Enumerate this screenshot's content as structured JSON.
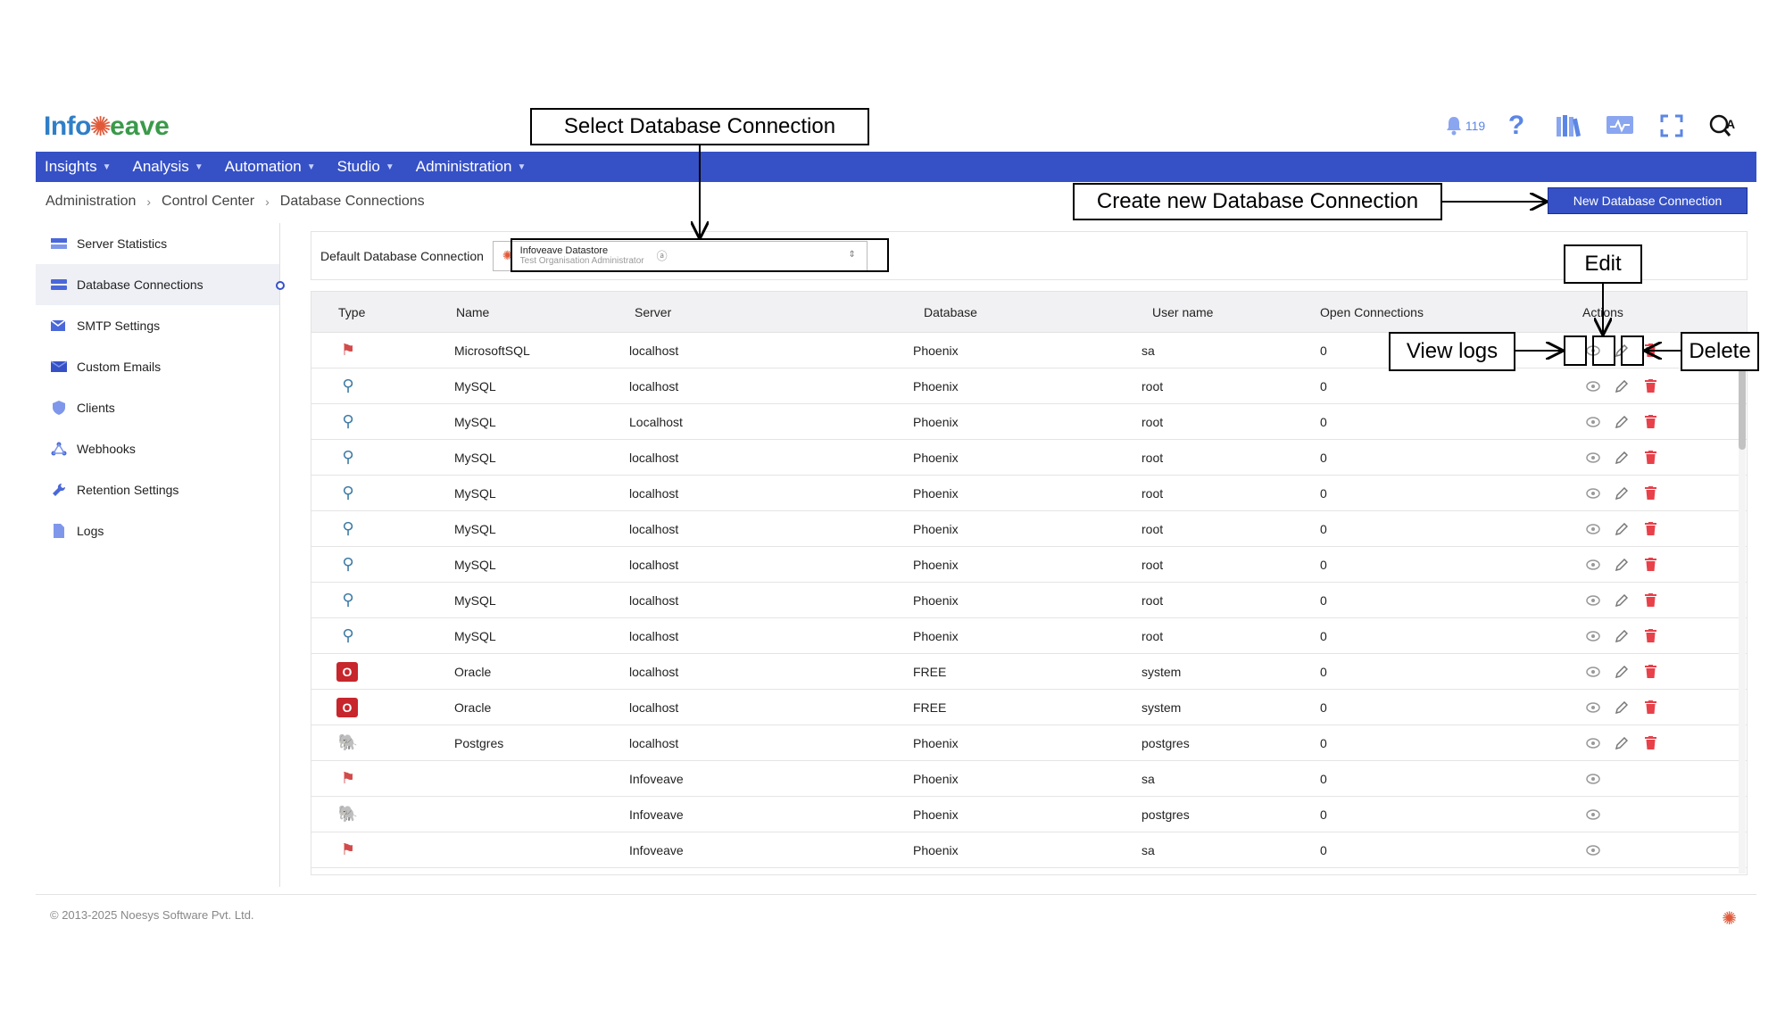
{
  "app": {
    "logo_part1": "Info",
    "logo_mark": "✺",
    "logo_part2": "eave",
    "logo_icon": "infoveave-logo"
  },
  "top_icons": {
    "notification_count": "119",
    "icons": [
      "bell-icon",
      "help-icon",
      "library-icon",
      "monitor-icon",
      "fullscreen-icon",
      "qa-icon"
    ]
  },
  "nav": [
    {
      "label": "Insights"
    },
    {
      "label": "Analysis"
    },
    {
      "label": "Automation"
    },
    {
      "label": "Studio"
    },
    {
      "label": "Administration"
    }
  ],
  "breadcrumb": [
    "Administration",
    "Control Center",
    "Database Connections"
  ],
  "new_button_label": "New Database Connection",
  "sidebar": {
    "items": [
      {
        "label": "Server Statistics",
        "icon": "server-stats-icon"
      },
      {
        "label": "Database Connections",
        "icon": "database-icon",
        "active": true
      },
      {
        "label": "SMTP Settings",
        "icon": "smtp-icon"
      },
      {
        "label": "Custom Emails",
        "icon": "email-icon"
      },
      {
        "label": "Clients",
        "icon": "shield-icon"
      },
      {
        "label": "Webhooks",
        "icon": "webhook-icon"
      },
      {
        "label": "Retention Settings",
        "icon": "wrench-icon"
      },
      {
        "label": "Logs",
        "icon": "document-icon"
      }
    ]
  },
  "default_connection": {
    "label": "Default Database Connection",
    "selected_name": "Infoveave Datastore",
    "selected_sub": "Test Organisation Administrator"
  },
  "table": {
    "headers": [
      "Type",
      "Name",
      "Server",
      "Database",
      "User name",
      "Open Connections",
      "Actions"
    ],
    "rows": [
      {
        "type": "mssql",
        "name": "MicrosoftSQL",
        "server": "localhost",
        "database": "Phoenix",
        "user": "sa",
        "open": "0",
        "actions": [
          "view",
          "edit",
          "delete"
        ]
      },
      {
        "type": "mysql",
        "name": "MySQL",
        "server": "localhost",
        "database": "Phoenix",
        "user": "root",
        "open": "0",
        "actions": [
          "view",
          "edit",
          "delete"
        ]
      },
      {
        "type": "mysql",
        "name": "MySQL",
        "server": "Localhost",
        "database": "Phoenix",
        "user": "root",
        "open": "0",
        "actions": [
          "view",
          "edit",
          "delete"
        ]
      },
      {
        "type": "mysql",
        "name": "MySQL",
        "server": "localhost",
        "database": "Phoenix",
        "user": "root",
        "open": "0",
        "actions": [
          "view",
          "edit",
          "delete"
        ]
      },
      {
        "type": "mysql",
        "name": "MySQL",
        "server": "localhost",
        "database": "Phoenix",
        "user": "root",
        "open": "0",
        "actions": [
          "view",
          "edit",
          "delete"
        ]
      },
      {
        "type": "mysql",
        "name": "MySQL",
        "server": "localhost",
        "database": "Phoenix",
        "user": "root",
        "open": "0",
        "actions": [
          "view",
          "edit",
          "delete"
        ]
      },
      {
        "type": "mysql",
        "name": "MySQL",
        "server": "localhost",
        "database": "Phoenix",
        "user": "root",
        "open": "0",
        "actions": [
          "view",
          "edit",
          "delete"
        ]
      },
      {
        "type": "mysql",
        "name": "MySQL",
        "server": "localhost",
        "database": "Phoenix",
        "user": "root",
        "open": "0",
        "actions": [
          "view",
          "edit",
          "delete"
        ]
      },
      {
        "type": "mysql",
        "name": "MySQL",
        "server": "localhost",
        "database": "Phoenix",
        "user": "root",
        "open": "0",
        "actions": [
          "view",
          "edit",
          "delete"
        ]
      },
      {
        "type": "oracle",
        "name": "Oracle",
        "server": "localhost",
        "database": "FREE",
        "user": "system",
        "open": "0",
        "actions": [
          "view",
          "edit",
          "delete"
        ]
      },
      {
        "type": "oracle",
        "name": "Oracle",
        "server": "localhost",
        "database": "FREE",
        "user": "system",
        "open": "0",
        "actions": [
          "view",
          "edit",
          "delete"
        ]
      },
      {
        "type": "postgres",
        "name": "Postgres",
        "server": "localhost",
        "database": "Phoenix",
        "user": "postgres",
        "open": "0",
        "actions": [
          "view",
          "edit",
          "delete"
        ]
      },
      {
        "type": "mssql",
        "name": "",
        "server": "Infoveave",
        "database": "Phoenix",
        "user": "sa",
        "open": "0",
        "actions": [
          "view"
        ]
      },
      {
        "type": "postgres",
        "name": "",
        "server": "Infoveave",
        "database": "Phoenix",
        "user": "postgres",
        "open": "0",
        "actions": [
          "view"
        ]
      },
      {
        "type": "mssql",
        "name": "",
        "server": "Infoveave",
        "database": "Phoenix",
        "user": "sa",
        "open": "0",
        "actions": [
          "view"
        ]
      }
    ]
  },
  "callouts": {
    "select": "Select Database Connection",
    "create": "Create new Database Connection",
    "edit": "Edit",
    "view_logs": "View logs",
    "delete": "Delete"
  },
  "footer": {
    "copyright": "© 2013-2025 Noesys Software Pvt. Ltd."
  },
  "colors": {
    "nav_bg": "#3651c6",
    "accent": "#3651c6",
    "delete": "#e8414a"
  }
}
